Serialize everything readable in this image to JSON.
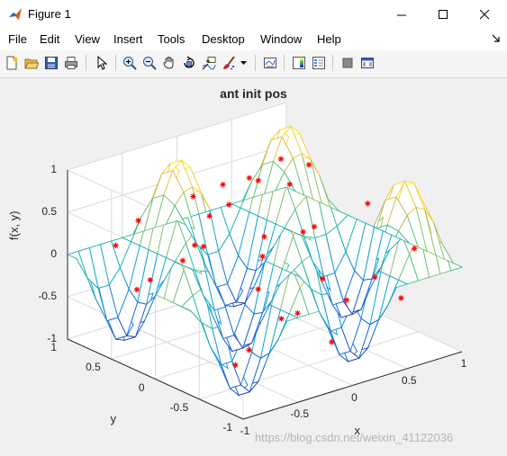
{
  "window": {
    "title": "Figure 1",
    "app_icon": "matlab-logo-icon"
  },
  "window_controls": {
    "minimize_icon": "minimize-icon",
    "maximize_icon": "maximize-icon",
    "close_icon": "close-icon"
  },
  "menubar": {
    "items": [
      "File",
      "Edit",
      "View",
      "Insert",
      "Tools",
      "Desktop",
      "Window",
      "Help"
    ]
  },
  "toolbar": {
    "icons": [
      "new-figure-icon",
      "open-file-icon",
      "save-icon",
      "print-icon",
      "edit-plot-arrow-icon",
      "zoom-in-icon",
      "zoom-out-icon",
      "pan-hand-icon",
      "rotate-3d-icon",
      "data-cursor-icon",
      "brush-icon",
      "brush-dropdown-icon",
      "link-plot-icon",
      "insert-colorbar-icon",
      "insert-legend-icon",
      "hide-plot-tools-icon",
      "show-plot-tools-icon"
    ]
  },
  "colors": {
    "marker": "#ff0000",
    "colormap": "parula",
    "axes_grid": "#dcdcdc",
    "axes_text": "#262626"
  },
  "chart_data": {
    "type": "surface",
    "title": "ant init pos",
    "xlabel": "x",
    "ylabel": "y",
    "zlabel": "f(x, y)",
    "xlim": [
      -1,
      1
    ],
    "ylim": [
      -1,
      1
    ],
    "zlim": [
      -1,
      1
    ],
    "x_ticks": [
      "-1",
      "-0.5",
      "0",
      "0.5",
      "1"
    ],
    "y_ticks": [
      "-1",
      "-0.5",
      "0",
      "0.5",
      "1"
    ],
    "z_ticks": [
      "-1",
      "-0.5",
      "0",
      "0.5",
      "1"
    ],
    "surface": {
      "function": "f(x, y) = sin(2*pi*x) * cos(1.5*pi*y)",
      "style": "mesh",
      "grid_points_x": 21,
      "grid_points_y": 21,
      "colormap": "parula"
    },
    "markers": {
      "symbol": "*",
      "color": "#ff0000",
      "name": "ant init pos",
      "points": [
        {
          "x": -0.68,
          "y": 0.85,
          "z": 0.05
        },
        {
          "x": -0.92,
          "y": 0.31,
          "z": -0.12
        },
        {
          "x": -0.55,
          "y": 0.62,
          "z": -0.3
        },
        {
          "x": -0.41,
          "y": 0.93,
          "z": 0.2
        },
        {
          "x": -0.23,
          "y": 0.12,
          "z": 0.7
        },
        {
          "x": -0.27,
          "y": -0.33,
          "z": 0.55
        },
        {
          "x": -0.75,
          "y": -0.6,
          "z": -0.65
        },
        {
          "x": -0.85,
          "y": -0.88,
          "z": -0.3
        },
        {
          "x": -0.12,
          "y": 0.48,
          "z": 0.35
        },
        {
          "x": 0.09,
          "y": 0.81,
          "z": -0.25
        },
        {
          "x": 0.18,
          "y": 0.3,
          "z": -0.55
        },
        {
          "x": 0.26,
          "y": -0.05,
          "z": -0.7
        },
        {
          "x": 0.33,
          "y": -0.52,
          "z": -0.35
        },
        {
          "x": 0.47,
          "y": 0.66,
          "z": 0.45
        },
        {
          "x": 0.58,
          "y": 0.22,
          "z": 0.8
        },
        {
          "x": 0.62,
          "y": -0.4,
          "z": 0.62
        },
        {
          "x": 0.71,
          "y": -0.82,
          "z": 0.25
        },
        {
          "x": 0.83,
          "y": 0.47,
          "z": -0.15
        },
        {
          "x": 0.91,
          "y": -0.12,
          "z": -0.5
        },
        {
          "x": 0.95,
          "y": 0.9,
          "z": 0.1
        },
        {
          "x": -0.05,
          "y": -0.72,
          "z": 0.15
        },
        {
          "x": 0.02,
          "y": 0.05,
          "z": 0.02
        },
        {
          "x": -0.35,
          "y": 0.38,
          "z": 0.72
        },
        {
          "x": 0.38,
          "y": 0.95,
          "z": 0.3
        },
        {
          "x": -0.6,
          "y": 0.05,
          "z": 0.4
        },
        {
          "x": 0.5,
          "y": -0.93,
          "z": -0.2
        },
        {
          "x": -0.95,
          "y": -0.25,
          "z": 0.5
        },
        {
          "x": 0.15,
          "y": -0.25,
          "z": 0.4
        },
        {
          "x": 0.75,
          "y": 0.75,
          "z": 0.55
        },
        {
          "x": -0.15,
          "y": -0.95,
          "z": -0.45
        },
        {
          "x": 0.3,
          "y": 0.55,
          "z": 0.6
        },
        {
          "x": -0.45,
          "y": -0.75,
          "z": -0.15
        }
      ]
    }
  },
  "watermark": "https://blog.csdn.net/weixin_41122036"
}
